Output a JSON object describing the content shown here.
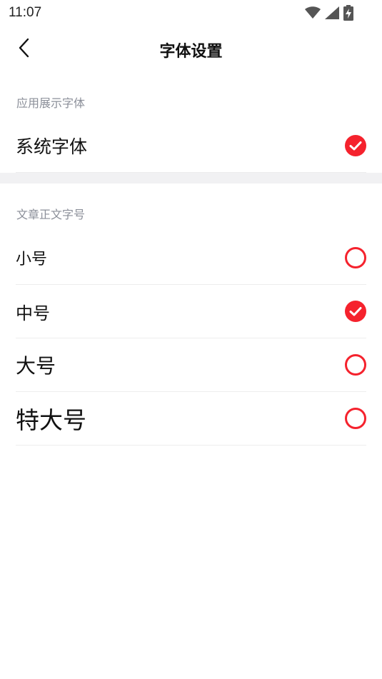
{
  "status_bar": {
    "time": "11:07",
    "icons": [
      "wifi-icon",
      "signal-icon",
      "battery-charging-icon"
    ]
  },
  "header": {
    "title": "字体设置",
    "back_icon": "chevron-left-icon"
  },
  "sections": {
    "app_font": {
      "label": "应用展示字体",
      "options": [
        {
          "label": "系统字体",
          "selected": true
        }
      ]
    },
    "article_font_size": {
      "label": "文章正文字号",
      "options": [
        {
          "label": "小号",
          "selected": false
        },
        {
          "label": "中号",
          "selected": true
        },
        {
          "label": "大号",
          "selected": false
        },
        {
          "label": "特大号",
          "selected": false
        }
      ]
    }
  },
  "colors": {
    "accent": "#f5222d",
    "section_label": "#8b8f99",
    "divider_band": "#f1f1f3"
  }
}
